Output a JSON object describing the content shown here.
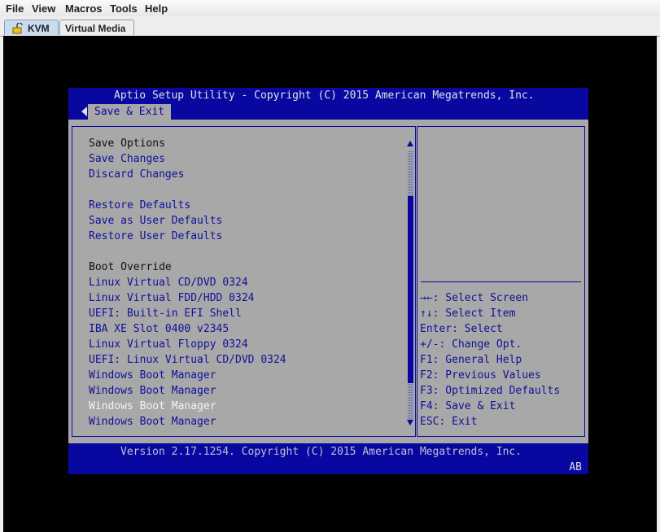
{
  "menubar": {
    "items": [
      "File",
      "View",
      "Macros",
      "Tools",
      "Help"
    ]
  },
  "tabs": [
    {
      "label": "KVM",
      "active": true
    },
    {
      "label": "Virtual Media",
      "active": false
    }
  ],
  "bios": {
    "title": "Aptio Setup Utility - Copyright (C) 2015 American Megatrends, Inc.",
    "active_tab": "Save & Exit",
    "items": [
      {
        "label": "Save Options",
        "type": "header"
      },
      {
        "label": "Save Changes",
        "type": "item"
      },
      {
        "label": "Discard Changes",
        "type": "item"
      },
      {
        "label": "",
        "type": "blank"
      },
      {
        "label": "Restore Defaults",
        "type": "item"
      },
      {
        "label": "Save as User Defaults",
        "type": "item"
      },
      {
        "label": "Restore User Defaults",
        "type": "item"
      },
      {
        "label": "",
        "type": "blank"
      },
      {
        "label": "Boot Override",
        "type": "header"
      },
      {
        "label": "Linux Virtual CD/DVD 0324",
        "type": "item"
      },
      {
        "label": "Linux Virtual FDD/HDD 0324",
        "type": "item"
      },
      {
        "label": "UEFI: Built-in EFI Shell",
        "type": "item"
      },
      {
        "label": "IBA XE Slot 0400 v2345",
        "type": "item"
      },
      {
        "label": "Linux Virtual Floppy 0324",
        "type": "item"
      },
      {
        "label": "UEFI: Linux Virtual CD/DVD 0324",
        "type": "item"
      },
      {
        "label": "Windows Boot Manager",
        "type": "item"
      },
      {
        "label": "Windows Boot Manager",
        "type": "item"
      },
      {
        "label": "Windows Boot Manager",
        "type": "selected"
      },
      {
        "label": "Windows Boot Manager",
        "type": "item"
      }
    ],
    "help": [
      "→←: Select Screen",
      "↑↓: Select Item",
      "Enter: Select",
      "+/-: Change Opt.",
      "F1: General Help",
      "F2: Previous Values",
      "F3: Optimized Defaults",
      "F4: Save & Exit",
      "ESC: Exit"
    ],
    "version": "Version 2.17.1254. Copyright (C) 2015 American Megatrends, Inc.",
    "status": "AB"
  },
  "colors": {
    "blue": "#0808a0",
    "grey": "#a8a8a8"
  }
}
